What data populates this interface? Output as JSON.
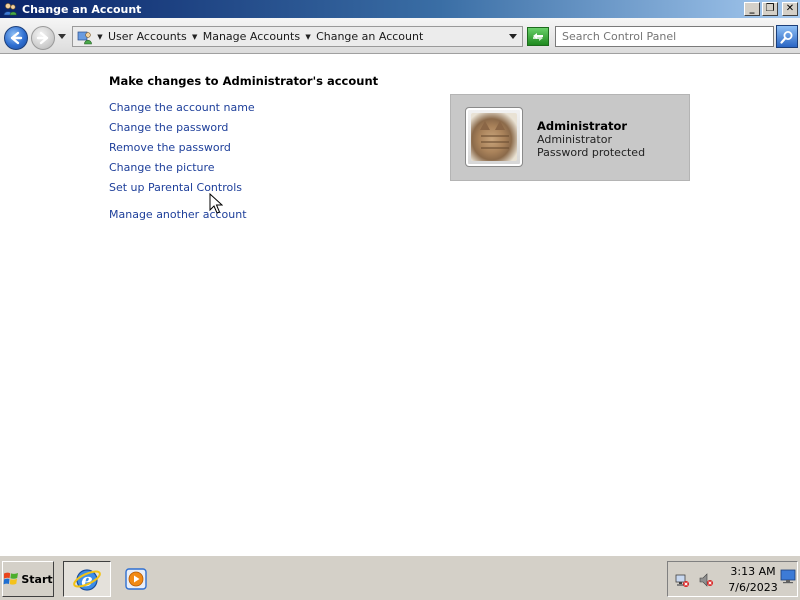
{
  "window": {
    "title": "Change an Account",
    "minimize_glyph": "_",
    "maximize_glyph": "❐",
    "close_glyph": "✕"
  },
  "address_bar": {
    "breadcrumbs": [
      "User Accounts",
      "Manage Accounts",
      "Change an Account"
    ],
    "search_placeholder": "Search Control Panel"
  },
  "main": {
    "heading": "Make changes to Administrator's account",
    "tasks": [
      "Change the account name",
      "Change the password",
      "Remove the password",
      "Change the picture",
      "Set up Parental Controls"
    ],
    "manage_other": "Manage another account"
  },
  "account_card": {
    "name": "Administrator",
    "type": "Administrator",
    "status": "Password protected",
    "picture_icon": "cat-picture"
  },
  "taskbar": {
    "start_label": "Start",
    "quick_launch": [
      "internet-explorer-icon",
      "media-player-icon"
    ],
    "tray_icons": [
      "network-disconnected-icon",
      "volume-muted-icon",
      "show-desktop-icon"
    ],
    "time": "3:13 AM",
    "date": "7/6/2023"
  },
  "colors": {
    "link": "#1e3f9a",
    "titlebar_start": "#0a246a",
    "titlebar_end": "#a6caf0",
    "card_bg": "#c8c8c8",
    "taskbar_bg": "#d4d0c8"
  }
}
